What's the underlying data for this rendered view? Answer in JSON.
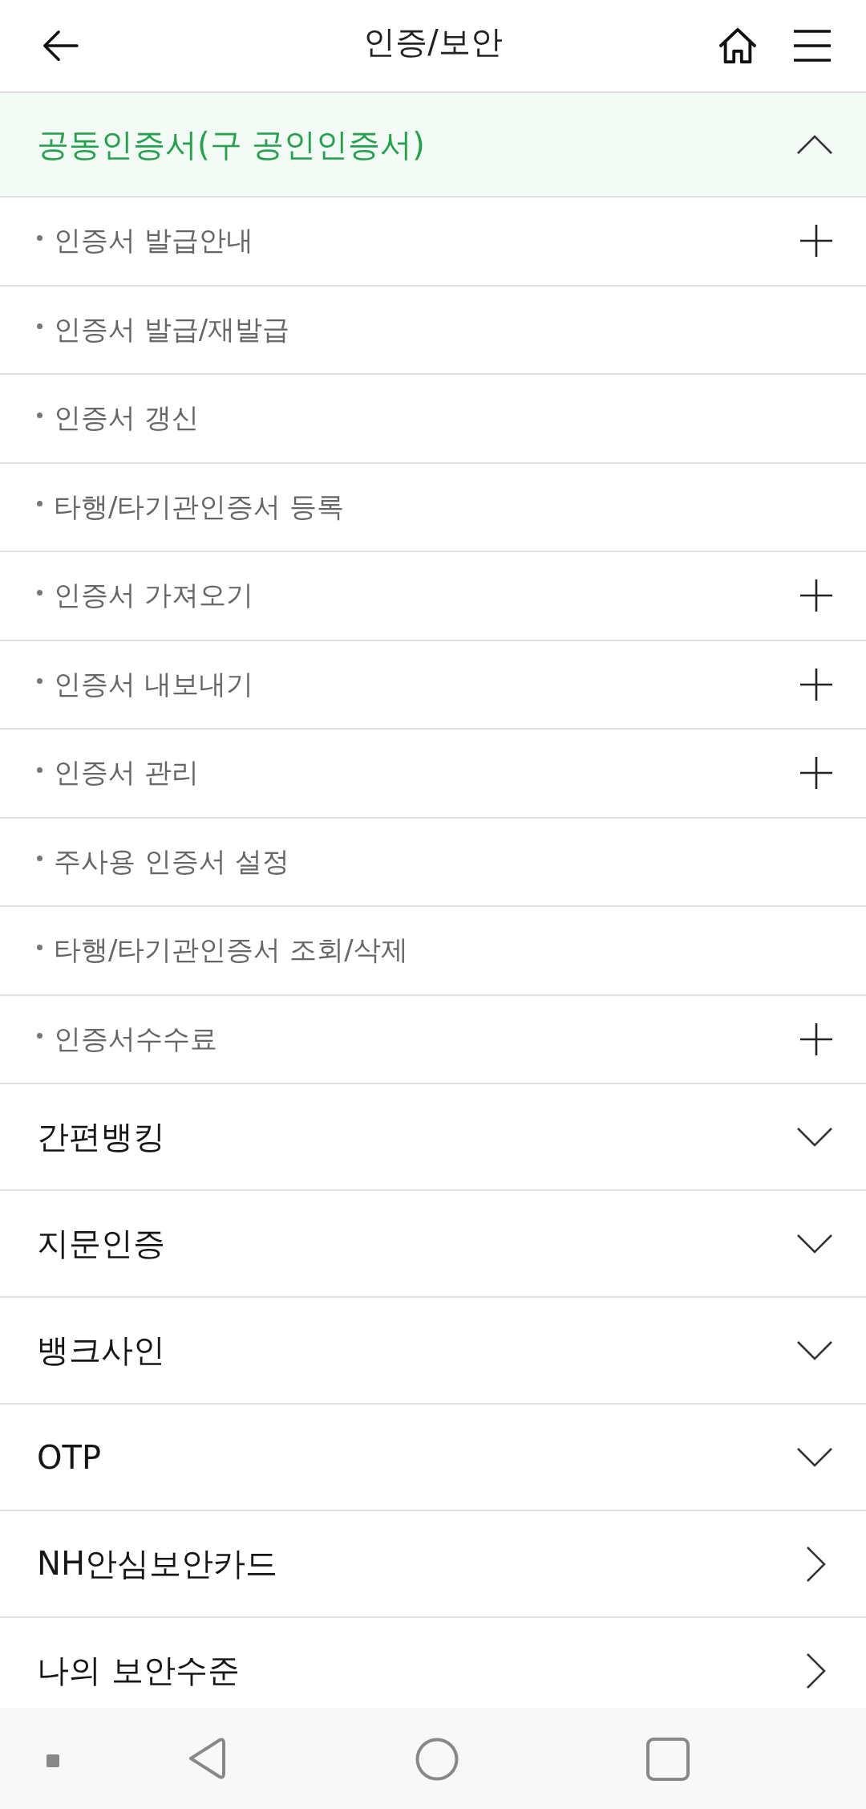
{
  "header": {
    "title": "인증/보안"
  },
  "menu": [
    {
      "kind": "accordion",
      "label": "공동인증서(구 공인인증서)",
      "expanded": true,
      "children": [
        {
          "label": "인증서 발급안내",
          "has_submenu": true
        },
        {
          "label": "인증서 발급/재발급",
          "has_submenu": false
        },
        {
          "label": "인증서 갱신",
          "has_submenu": false
        },
        {
          "label": "타행/타기관인증서 등록",
          "has_submenu": false
        },
        {
          "label": "인증서 가져오기",
          "has_submenu": true
        },
        {
          "label": "인증서 내보내기",
          "has_submenu": true
        },
        {
          "label": "인증서 관리",
          "has_submenu": true
        },
        {
          "label": "주사용 인증서 설정",
          "has_submenu": false
        },
        {
          "label": "타행/타기관인증서 조회/삭제",
          "has_submenu": false
        },
        {
          "label": "인증서수수료",
          "has_submenu": true
        }
      ]
    },
    {
      "kind": "accordion",
      "label": "간편뱅킹",
      "expanded": false
    },
    {
      "kind": "accordion",
      "label": "지문인증",
      "expanded": false
    },
    {
      "kind": "accordion",
      "label": "뱅크사인",
      "expanded": false
    },
    {
      "kind": "accordion",
      "label": "OTP",
      "expanded": false
    },
    {
      "kind": "link",
      "label": "NH안심보안카드"
    },
    {
      "kind": "link",
      "label": "나의 보안수준"
    }
  ]
}
